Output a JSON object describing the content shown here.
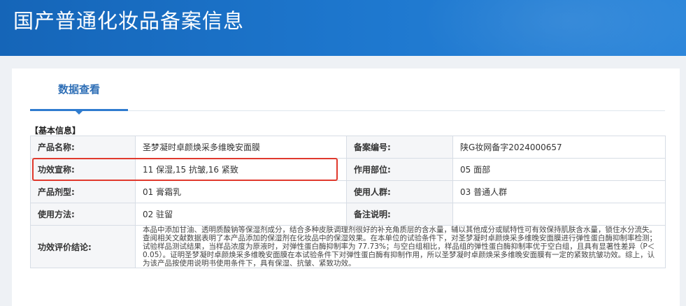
{
  "banner": {
    "title": "国产普通化妆品备案信息"
  },
  "tabs": [
    {
      "label": "数据查看"
    }
  ],
  "section": {
    "title": "【基本信息】"
  },
  "rows": {
    "product_name": {
      "label": "产品名称:",
      "value": "圣梦凝时卓颜焕采多维晚安面膜"
    },
    "record_no": {
      "label": "备案编号:",
      "value": "陕G妆网备字2024000657"
    },
    "efficacy": {
      "label": "功效宣称:",
      "value": "11 保湿,15 抗皱,16 紧致"
    },
    "site": {
      "label": "作用部位:",
      "value": "05 面部"
    },
    "dosage_form": {
      "label": "产品剂型:",
      "value": "01 膏霜乳"
    },
    "population": {
      "label": "使用人群:",
      "value": "03 普通人群"
    },
    "usage": {
      "label": "使用方法:",
      "value": "02 驻留"
    },
    "remarks": {
      "label": "备注说明:",
      "value": ""
    },
    "evaluation": {
      "label": "功效评价结论:",
      "value": "本品中添加甘油、透明质酸钠等保湿剂成分，结合多种皮肤调理剂很好的补充角质层的含水量，辅以其他成分或赋特性可有效保持肌肤含水量，锁住水分流失。查阅相关文献数据表明了本产品添加的保湿剂在化妆品中的保湿效果。在本单位的试验条件下，对圣梦凝时卓颜焕采多维晚安面膜进行弹性蛋白酶抑制率检测；试验样品测试结果，当样品浓度为原液时，对弹性蛋白酶抑制率为 77.73%；与空白组相比，样品组的弹性蛋白酶抑制率优于空白组，且具有显著性差异（P＜0.05）。证明圣梦凝时卓颜焕采多维晚安面膜在本试验条件下对弹性蛋白酶有抑制作用，所以圣梦凝时卓颜焕采多维晚安面膜有一定的紧致抗皱功效。综上，认为该产品按使用说明书使用条件下，具有保湿、抗皱、紧致功效。"
    }
  },
  "colors": {
    "banner": "#1e78cf",
    "tab_accent": "#2f7ccf",
    "highlight_border": "#e0392d"
  }
}
